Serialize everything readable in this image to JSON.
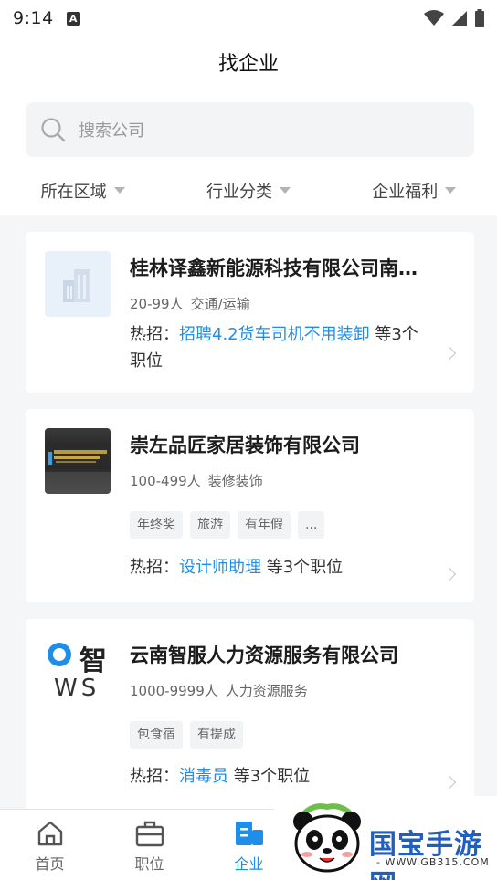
{
  "status_bar": {
    "time": "9:14",
    "notif_letter": "A"
  },
  "header": {
    "title": "找企业"
  },
  "search": {
    "placeholder": "搜索公司"
  },
  "filters": [
    {
      "label": "所在区域"
    },
    {
      "label": "行业分类"
    },
    {
      "label": "企业福利"
    }
  ],
  "companies": [
    {
      "name": "桂林译鑫新能源科技有限公司南…",
      "size": "20-99人",
      "industry": "交通/运输",
      "hot_prefix": "热招：",
      "hot_job": "招聘4.2货车司机不用装卸",
      "hot_suffix": " 等3个",
      "hot_suffix2": "职位",
      "tags": []
    },
    {
      "name": "崇左品匠家居装饰有限公司",
      "size": "100-499人",
      "industry": "装修装饰",
      "hot_prefix": "热招：",
      "hot_job": "设计师助理",
      "hot_suffix": " 等3个职位",
      "tags": [
        "年终奖",
        "旅游",
        "有年假",
        "..."
      ]
    },
    {
      "name": "云南智服人力资源服务有限公司",
      "size": "1000-9999人",
      "industry": "人力资源服务",
      "hot_prefix": "热招：",
      "hot_job": "消毒员",
      "hot_suffix": " 等3个职位",
      "tags": [
        "包食宿",
        "有提成"
      ],
      "logo_text_top": "智",
      "logo_text_bottom": "WS"
    }
  ],
  "bottom_nav": [
    {
      "label": "首页",
      "icon": "home-icon",
      "active": false
    },
    {
      "label": "职位",
      "icon": "briefcase-icon",
      "active": false
    },
    {
      "label": "企业",
      "icon": "building-icon",
      "active": true
    }
  ],
  "watermark": {
    "brand": "国宝手游网",
    "url": "- WWW.GB315.COM -"
  },
  "colors": {
    "accent": "#1f8ee8",
    "background": "#f5f6f8"
  }
}
